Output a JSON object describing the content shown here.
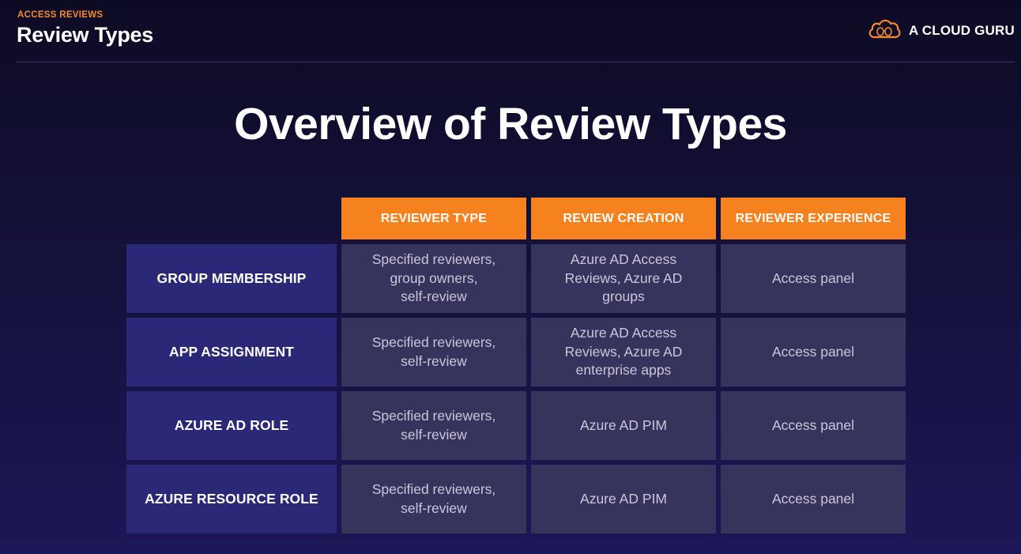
{
  "header": {
    "eyebrow": "ACCESS REVIEWS",
    "title": "Review Types",
    "brand": "A CLOUD GURU",
    "brand_icon": "cloud-logo-icon"
  },
  "slide": {
    "title": "Overview of Review Types"
  },
  "colors": {
    "accent": "#f5811f",
    "row_label_bg": "#2a2877",
    "cell_bg": "#36345d"
  },
  "table": {
    "columns": [
      "REVIEWER TYPE",
      "REVIEW CREATION",
      "REVIEWER EXPERIENCE"
    ],
    "rows": [
      {
        "label": "GROUP MEMBERSHIP",
        "cells": [
          "Specified reviewers,\ngroup owners,\nself-review",
          "Azure AD Access\nReviews, Azure AD\ngroups",
          "Access panel"
        ]
      },
      {
        "label": "APP ASSIGNMENT",
        "cells": [
          "Specified reviewers,\nself-review",
          "Azure AD Access\nReviews, Azure AD\nenterprise apps",
          "Access panel"
        ]
      },
      {
        "label": "AZURE AD ROLE",
        "cells": [
          "Specified reviewers,\nself-review",
          "Azure AD PIM",
          "Access panel"
        ]
      },
      {
        "label": "AZURE RESOURCE ROLE",
        "cells": [
          "Specified reviewers,\nself-review",
          "Azure AD PIM",
          "Access panel"
        ]
      }
    ]
  }
}
